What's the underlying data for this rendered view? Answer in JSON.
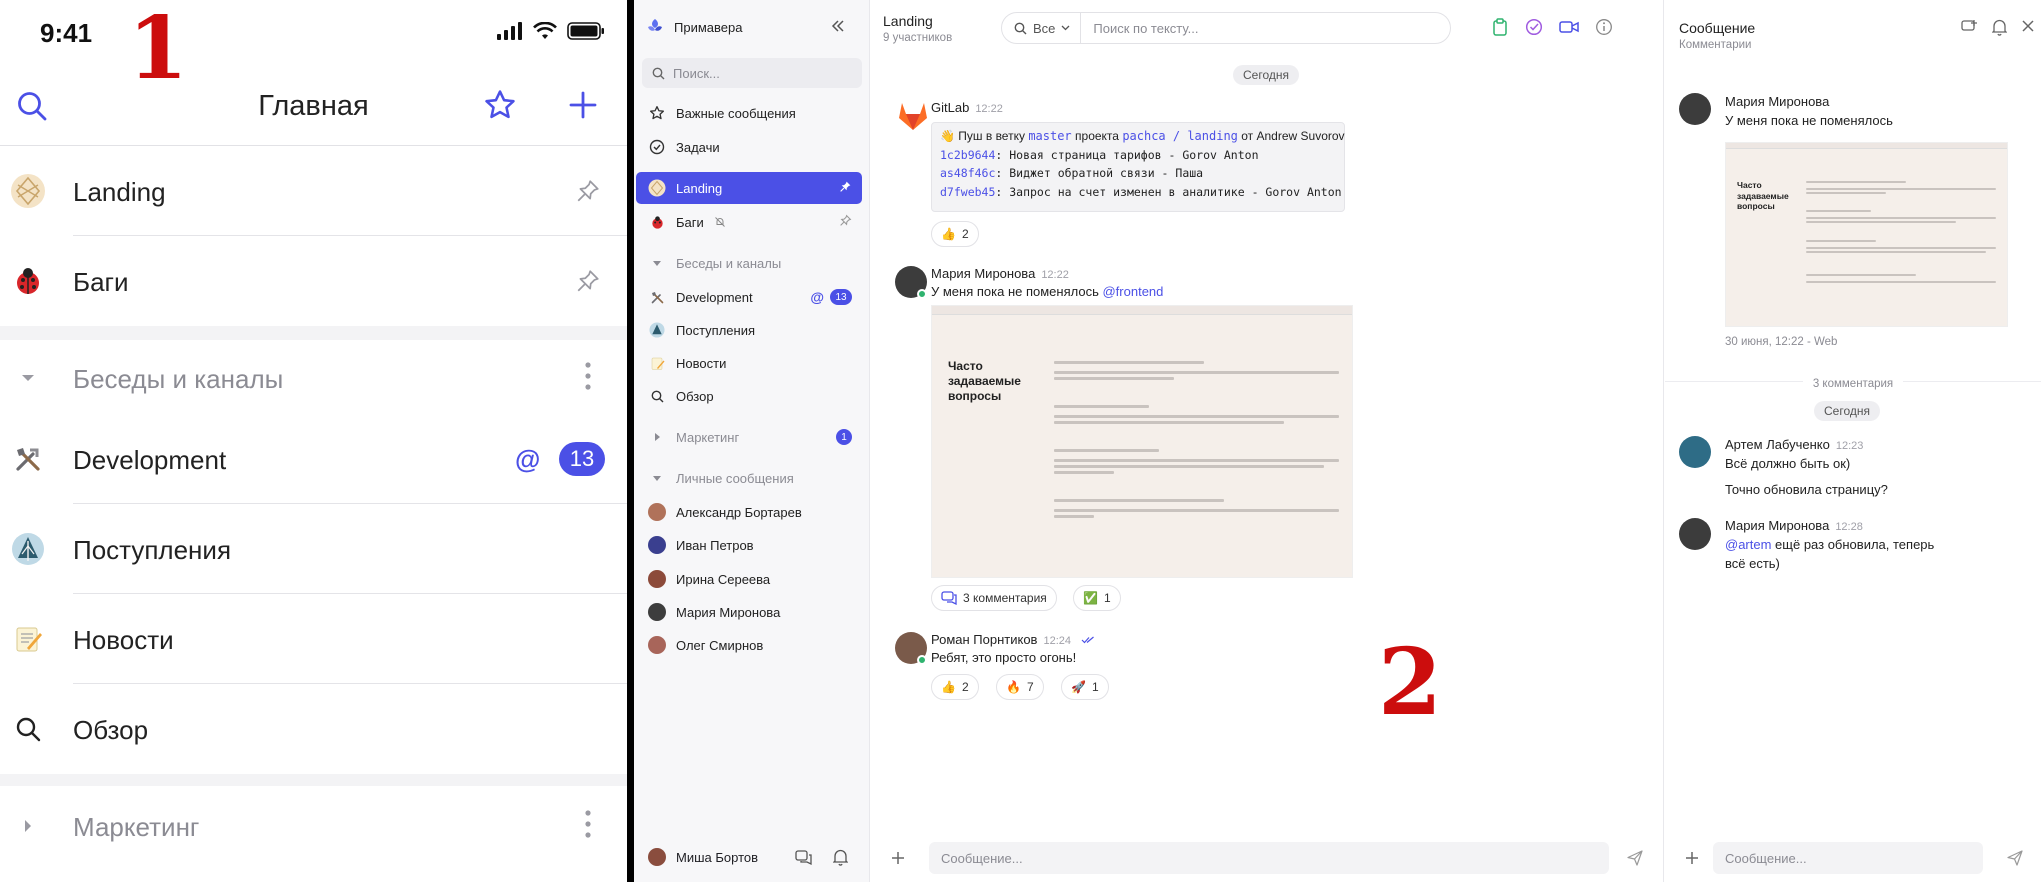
{
  "phone": {
    "status_time": "9:41",
    "marker": "1",
    "title": "Главная",
    "pinned": [
      {
        "label": "Landing",
        "icon": "landing-logo-icon"
      },
      {
        "label": "Баги",
        "icon": "ladybug-icon"
      }
    ],
    "section_chats": "Беседы и каналы",
    "channels": [
      {
        "label": "Development",
        "icon": "tools-icon",
        "mention": "@",
        "badge": "13"
      },
      {
        "label": "Поступления",
        "icon": "tree-icon"
      },
      {
        "label": "Новости",
        "icon": "memo-icon"
      },
      {
        "label": "Обзор",
        "icon": "search-icon"
      }
    ],
    "section_marketing": "Маркетинг"
  },
  "desktop": {
    "marker": "2",
    "workspace": "Примавера",
    "search_placeholder": "Поиск...",
    "nav": [
      {
        "label": "Важные сообщения",
        "icon": "star-icon"
      },
      {
        "label": "Задачи",
        "icon": "check-circle-icon"
      }
    ],
    "pinned": [
      {
        "label": "Landing",
        "active": true
      },
      {
        "label": "Баги",
        "muted": true
      }
    ],
    "section_chats": "Беседы и каналы",
    "channels": [
      {
        "label": "Development",
        "mention": "@",
        "badge": "13"
      },
      {
        "label": "Поступления"
      },
      {
        "label": "Новости"
      },
      {
        "label": "Обзор"
      }
    ],
    "section_marketing": "Маркетинг",
    "marketing_badge": "1",
    "section_personal": "Личные сообщения",
    "people": [
      {
        "name": "Александр Бортарев",
        "color": "#b0725a"
      },
      {
        "name": "Иван Петров",
        "color": "#3a3f8f"
      },
      {
        "name": "Ирина Сереева",
        "color": "#8c4a3a"
      },
      {
        "name": "Мария Миронова",
        "color": "#3d3d3d"
      },
      {
        "name": "Олег Смирнов",
        "color": "#a8655a"
      }
    ],
    "current_user": "Миша Бортов",
    "chat": {
      "title": "Landing",
      "subtitle": "9 участников",
      "filter": "Все",
      "search_placeholder": "Поиск по тексту...",
      "day": "Сегодня",
      "gitlab": {
        "author": "GitLab",
        "time": "12:22",
        "push_prefix": "👋 Пуш в ветку",
        "branch": "master",
        "project_word": "проекта",
        "project": "pachca / landing",
        "from": "от Andrew Suvorov",
        "commits": [
          {
            "hash": "1c2b9644",
            "text": ": Новая страница тарифов - Gorov Anton"
          },
          {
            "hash": "as48f46c",
            "text": ": Виджет обратной связи - Паша"
          },
          {
            "hash": "d7fweb45",
            "text": ": Запрос на счет изменен в аналитике - Gorov Anton"
          }
        ],
        "reaction": {
          "emoji": "👍",
          "count": "2"
        }
      },
      "maria": {
        "author": "Мария Миронова",
        "time": "12:22",
        "text": "У меня пока не поменялось ",
        "mention": "@frontend",
        "thumb_title": "Часто задаваемые вопросы",
        "comments": "3 комментария",
        "reaction": {
          "emoji": "✅",
          "count": "1"
        }
      },
      "roman": {
        "author": "Роман Порнтиков",
        "time": "12:24",
        "text": "Ребят, это просто огонь!",
        "reactions": [
          {
            "emoji": "👍",
            "count": "2"
          },
          {
            "emoji": "🔥",
            "count": "7"
          },
          {
            "emoji": "🚀",
            "count": "1"
          }
        ]
      },
      "input_placeholder": "Сообщение..."
    },
    "thread": {
      "title": "Сообщение",
      "subtitle": "Комментарии",
      "root_author": "Мария Миронова",
      "root_text": "У меня пока не поменялось",
      "thumb_title": "Часто задаваемые вопросы",
      "root_meta": "30 июня, 12:22 - Web",
      "comments_count": "3 комментария",
      "day": "Сегодня",
      "replies": [
        {
          "author": "Артем Лабученко",
          "time": "12:23",
          "lines": [
            "Всё должно быть ок)",
            "Точно обновила страницу?"
          ]
        },
        {
          "author": "Мария Миронова",
          "time": "12:28",
          "mention": "@artem",
          "line1": " ещё раз обновила, теперь",
          "line2": "всё есть)"
        }
      ],
      "input_placeholder": "Сообщение..."
    }
  },
  "colors": {
    "accent": "#4b50e6",
    "marker_red": "#cc0d0d"
  }
}
